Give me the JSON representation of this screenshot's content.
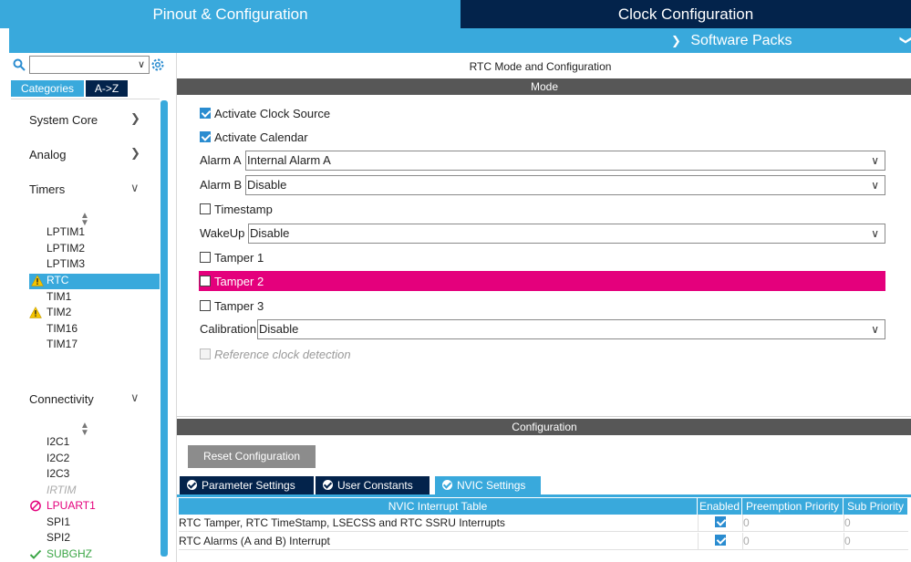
{
  "tabs": {
    "pinout": "Pinout & Configuration",
    "clock": "Clock Configuration",
    "software_packs": "Software Packs"
  },
  "left": {
    "search_value": "",
    "category_tabs": [
      "Categories",
      "A->Z"
    ],
    "categories": [
      {
        "label": "System Core",
        "state": "collapsed"
      },
      {
        "label": "Analog",
        "state": "collapsed"
      },
      {
        "label": "Timers",
        "state": "expanded"
      },
      {
        "label": "Connectivity",
        "state": "expanded"
      }
    ],
    "timers": [
      {
        "label": "LPTIM1",
        "status": "none"
      },
      {
        "label": "LPTIM2",
        "status": "none"
      },
      {
        "label": "LPTIM3",
        "status": "none"
      },
      {
        "label": "RTC",
        "status": "warning",
        "selected": true
      },
      {
        "label": "TIM1",
        "status": "none"
      },
      {
        "label": "TIM2",
        "status": "warning"
      },
      {
        "label": "TIM16",
        "status": "none"
      },
      {
        "label": "TIM17",
        "status": "none"
      }
    ],
    "connectivity": [
      {
        "label": "I2C1",
        "status": "none"
      },
      {
        "label": "I2C2",
        "status": "none"
      },
      {
        "label": "I2C3",
        "status": "none"
      },
      {
        "label": "IRTIM",
        "status": "disabled"
      },
      {
        "label": "LPUART1",
        "status": "error"
      },
      {
        "label": "SPI1",
        "status": "none"
      },
      {
        "label": "SPI2",
        "status": "none"
      },
      {
        "label": "SUBGHZ",
        "status": "ok"
      }
    ]
  },
  "main": {
    "title": "RTC Mode and Configuration",
    "mode_header": "Mode",
    "activate_clock_source": {
      "label": "Activate Clock Source",
      "checked": true
    },
    "activate_calendar": {
      "label": "Activate Calendar",
      "checked": true
    },
    "alarm_a": {
      "label": "Alarm A",
      "value": "Internal Alarm A"
    },
    "alarm_b": {
      "label": "Alarm B",
      "value": "Disable"
    },
    "timestamp": {
      "label": "Timestamp",
      "checked": false
    },
    "wakeup": {
      "label": "WakeUp",
      "value": "Disable"
    },
    "tamper1": {
      "label": "Tamper 1",
      "checked": false
    },
    "tamper2": {
      "label": "Tamper 2",
      "checked": false
    },
    "tamper3": {
      "label": "Tamper 3",
      "checked": false
    },
    "calibration": {
      "label": "Calibration",
      "value": "Disable"
    },
    "ref_clock": {
      "label": "Reference clock detection",
      "checked": false,
      "disabled": true
    },
    "config_header": "Configuration",
    "reset_button": "Reset Configuration",
    "param_tabs": [
      "Parameter Settings",
      "User Constants",
      "NVIC Settings"
    ],
    "active_param_tab": "NVIC Settings",
    "nvic": {
      "columns": [
        "NVIC Interrupt Table",
        "Enabled",
        "Preemption Priority",
        "Sub Priority"
      ],
      "rows": [
        {
          "name": "RTC Tamper, RTC TimeStamp, LSECSS and RTC SSRU Interrupts",
          "enabled": true,
          "preemption": "0",
          "sub": "0"
        },
        {
          "name": "RTC Alarms (A and B) Interrupt",
          "enabled": true,
          "preemption": "0",
          "sub": "0"
        }
      ]
    }
  },
  "colors": {
    "accent": "#39a9dc",
    "navy": "#03234b",
    "highlight": "#e4007c",
    "section_gray": "#575757",
    "warning": "#f5c400",
    "ok": "#3aa545"
  }
}
